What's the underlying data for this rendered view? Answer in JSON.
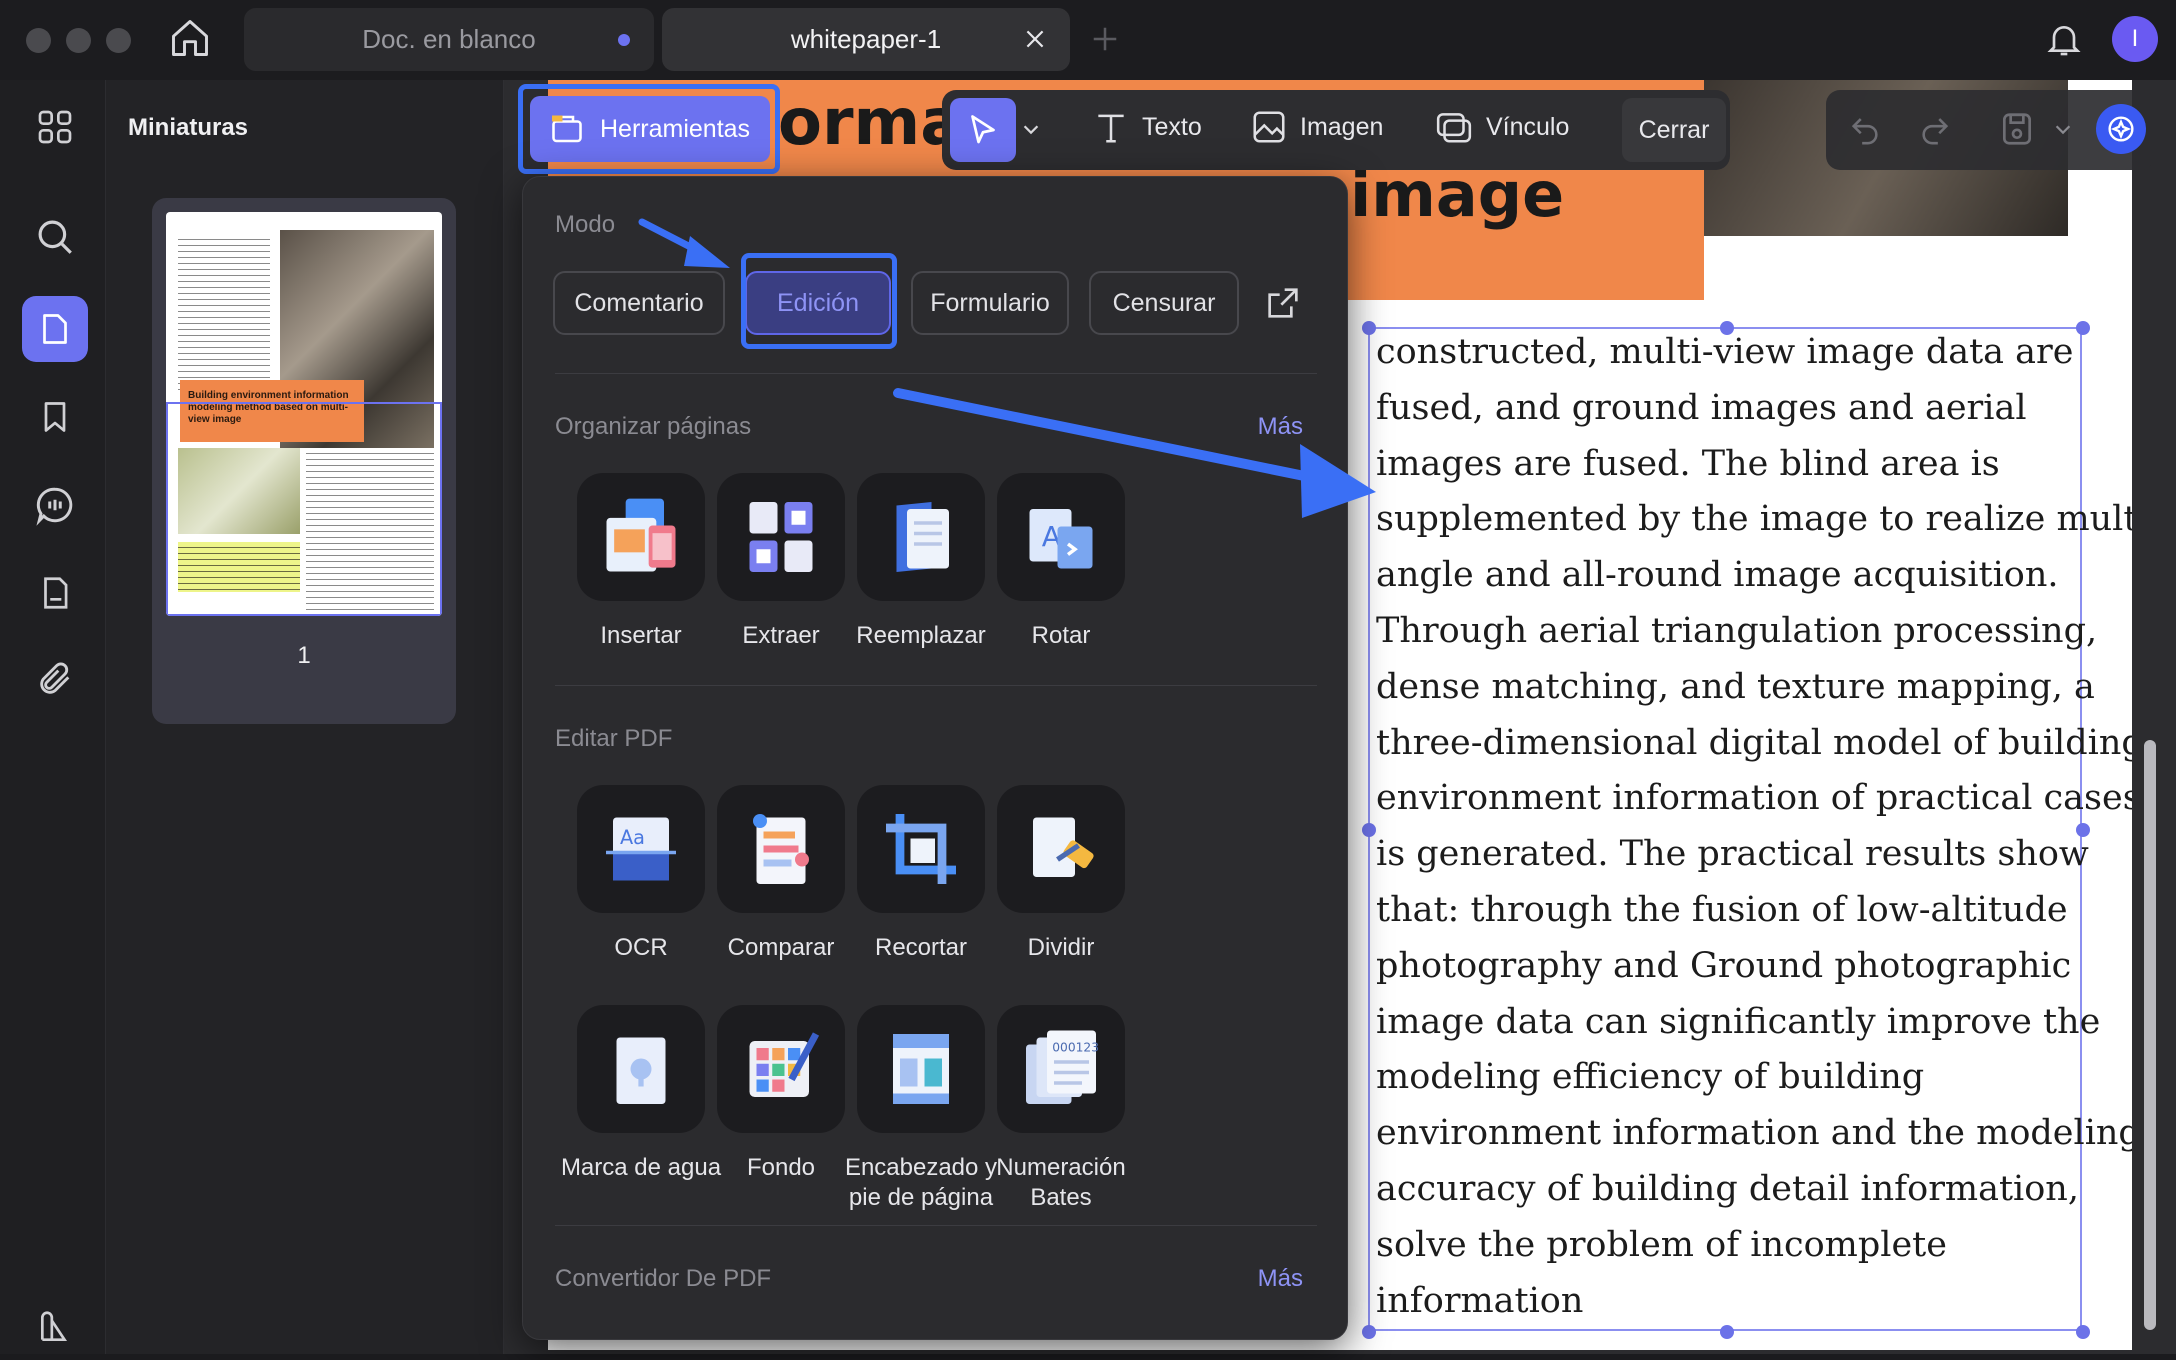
{
  "window": {
    "tabs": [
      {
        "label": "Doc. en blanco",
        "active": false
      },
      {
        "label": "whitepaper-1",
        "active": true
      }
    ],
    "avatar_initial": "I"
  },
  "thumbnails_panel": {
    "title": "Miniaturas",
    "thumb_title": "Building environment information modeling method based on multi-view image",
    "page_number": "1"
  },
  "toolbar": {
    "tools_label": "Herramientas",
    "texto_label": "Texto",
    "imagen_label": "Imagen",
    "vinculo_label": "Vínculo",
    "cerrar_label": "Cerrar"
  },
  "document": {
    "heading_fragment_1": "ormat",
    "heading_fragment_2": "image",
    "paragraph_lines": [
      "constructed, multi-view image data are",
      "fused, and ground images and aerial",
      "images are fused. The blind area is",
      "supplemented by the image to realize multi-",
      "angle and all-round image acquisition.",
      "Through aerial triangulation processing,",
      "dense matching, and texture mapping, a",
      "three-dimensional digital model of building",
      "environment information of practical cases",
      "is generated. The practical results show",
      "that: through the fusion of low-altitude",
      "photography and Ground photographic",
      "image data can significantly improve the",
      "modeling efficiency of building",
      "environment information and the modeling",
      "accuracy of building detail information,",
      "solve the problem of incomplete",
      "information"
    ]
  },
  "popup": {
    "mode_title": "Modo",
    "modes": [
      "Comentario",
      "Edición",
      "Formulario",
      "Censurar"
    ],
    "organize_title": "Organizar páginas",
    "organize_more": "Más",
    "organize_tools": [
      "Insertar",
      "Extraer",
      "Reemplazar",
      "Rotar"
    ],
    "edit_title": "Editar PDF",
    "edit_tools": [
      "OCR",
      "Comparar",
      "Recortar",
      "Dividir"
    ],
    "edit_tools_2": [
      "Marca de agua",
      "Fondo",
      "Encabezado y pie de página",
      "Numeración Bates"
    ],
    "converter_title": "Convertidor De PDF",
    "converter_more": "Más"
  },
  "colors": {
    "accent": "#6c72f0",
    "highlight_border": "#3a6ff5",
    "orange": "#f0874a"
  }
}
